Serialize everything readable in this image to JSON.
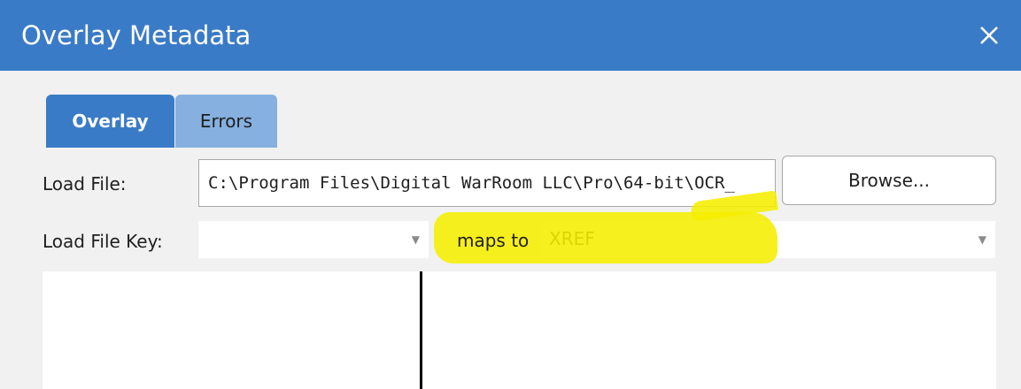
{
  "dialog": {
    "title": "Overlay Metadata",
    "close_icon": "close-icon"
  },
  "tabs": [
    {
      "label": "Overlay",
      "active": true
    },
    {
      "label": "Errors",
      "active": false
    }
  ],
  "load_file": {
    "label": "Load File:",
    "value": "C:\\Program Files\\Digital WarRoom LLC\\Pro\\64-bit\\OCR_",
    "browse_label": "Browse..."
  },
  "load_file_key": {
    "label": "Load File Key:",
    "value": "",
    "maps_to_label": "maps to",
    "maps_to_value": "XREF",
    "dropdown_icon": "chevron-down-icon"
  },
  "colors": {
    "titlebar": "#3a7bc7",
    "tab_active": "#3a7bc7",
    "tab_inactive": "#86b0df",
    "highlight": "#f6ee00"
  }
}
